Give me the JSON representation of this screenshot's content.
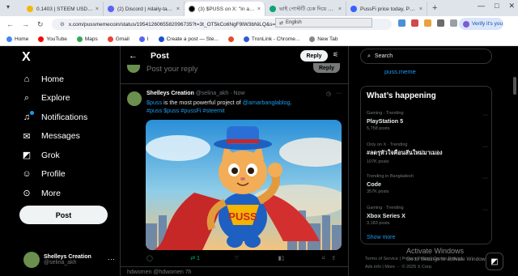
{
  "browser": {
    "tabs": [
      {
        "title": "0.1403 | STEEM USDT | Stee",
        "color": "#f0b90b"
      },
      {
        "title": "(2) Discord | #daily-tasks | আম",
        "color": "#5865f2"
      },
      {
        "title": "(3) $PUSS on X: \"In a marke",
        "color": "#000000",
        "active": true
      },
      {
        "title": "ভাই পোস্টটি চেক দিয়ে আমাদে",
        "color": "#0ea472"
      },
      {
        "title": "PussFi price today, PUSS to",
        "color": "#3861fb"
      }
    ],
    "url": "x.com/pussmemecoin/status/1954126065582096735?t=3t_OT5kCo6NgF9lW3bNiLQ&s=19",
    "translate_label": "English",
    "verify_label": "Verify it's you",
    "bookmarks": [
      {
        "label": "Home",
        "color": "#4285f4"
      },
      {
        "label": "YouTube",
        "color": "#ff0000"
      },
      {
        "label": "Maps",
        "color": "#34a853"
      },
      {
        "label": "Gmail",
        "color": "#ea4335"
      },
      {
        "label": "I",
        "color": "#5865f2"
      },
      {
        "label": "Create a post — Ste...",
        "color": "#1a51d4"
      },
      {
        "label": "",
        "color": "#e44d26"
      },
      {
        "label": "TronLink - Chrome...",
        "color": "#2d5bd0"
      },
      {
        "label": "New Tab",
        "color": "#888888"
      }
    ]
  },
  "sidebar": {
    "logo": "X",
    "items": [
      {
        "label": "Home",
        "icon": "⌂",
        "name": "home"
      },
      {
        "label": "Explore",
        "icon": "⌕",
        "name": "explore"
      },
      {
        "label": "Notifications",
        "icon": "⍾",
        "name": "notifications"
      },
      {
        "label": "Messages",
        "icon": "✉",
        "name": "messages"
      },
      {
        "label": "Grok",
        "icon": "◪",
        "name": "grok"
      },
      {
        "label": "Profile",
        "icon": "☺",
        "name": "profile"
      },
      {
        "label": "More",
        "icon": "⋯",
        "name": "more"
      }
    ],
    "post_label": "Post",
    "user_name": "Shelleys Creation",
    "user_handle": "@selina_akh",
    "more_icon": "···"
  },
  "main": {
    "header_title": "Post",
    "reply_button": "Reply",
    "composer_placeholder": "Post your reply",
    "composer_reply": "Reply",
    "tweet": {
      "author": "Shelleys Creation",
      "handle": "@selina_akh",
      "time": "· Now",
      "line1_prefix": "$puss",
      "line1_text": " is the most powerful project of ",
      "line1_mention": "@amarbanglablog",
      "line1_suffix": ".",
      "line2": "#puss $puss #pussFi #steemit",
      "image_text": "PUSS",
      "retweets": "1"
    },
    "next_handle": "hdwomen  @hdwomen 7h"
  },
  "right": {
    "search_placeholder": "Search",
    "puss_link": "puss.meme",
    "whats_happening": "What’s happening",
    "trends": [
      {
        "context": "Gaming · Trending",
        "title": "PlayStation 5",
        "count": "5,758 posts"
      },
      {
        "context": "Only on X · Trending",
        "title": "#ลดรุหัวใจคือนสันใหม่มาเมอง",
        "count": "107K posts"
      },
      {
        "context": "Trending in Bangladesh",
        "title": "Code",
        "count": "357K posts"
      },
      {
        "context": "Gaming · Trending",
        "title": "Xbox Series X",
        "count": "3,183 posts"
      }
    ],
    "show_more": "Show more",
    "footer_line1": "Terms of Service  |  Privacy Policy  |  Cookie Policy  |",
    "footer_line2": "Ads info  |  More ···  © 2025 X Corp."
  },
  "windows": {
    "activate_title": "Activate Windows",
    "activate_sub": "Go to Settings to activate Windows."
  }
}
